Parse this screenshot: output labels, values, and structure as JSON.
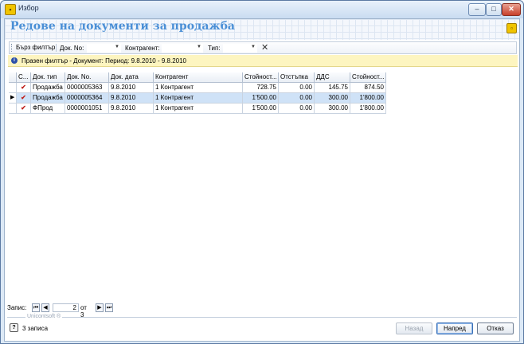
{
  "window": {
    "title": "Избор"
  },
  "header": {
    "title": "Редове на документи за продажба"
  },
  "toolbar": {
    "quick_filter": "Бърз филтър",
    "doc_no_label": "Док. No:",
    "contractor_label": "Контрагент:",
    "type_label": "Тип:"
  },
  "info": {
    "text": "Празен филтър - Документ: Период: 9.8.2010 - 9.8.2010"
  },
  "table": {
    "columns": [
      "С...",
      "Док. тип",
      "Док. No.",
      "Док. дата",
      "Контрагент",
      "Стойност...",
      "Отстъпка",
      "ДДС",
      "Стойност..."
    ],
    "rows": [
      {
        "checked": true,
        "type": "Продажба",
        "no": "0000005363",
        "date": "9.8.2010",
        "contractor": "1 Контрагент",
        "value": "728.75",
        "discount": "0.00",
        "vat": "145.75",
        "total": "874.50"
      },
      {
        "checked": true,
        "type": "Продажба",
        "no": "0000005364",
        "date": "9.8.2010",
        "contractor": "1 Контрагент",
        "value": "1'500.00",
        "discount": "0.00",
        "vat": "300.00",
        "total": "1'800.00"
      },
      {
        "checked": true,
        "type": "ФПрод",
        "no": "0000001051",
        "date": "9.8.2010",
        "contractor": "1 Контрагент",
        "value": "1'500.00",
        "discount": "0.00",
        "vat": "300.00",
        "total": "1'800.00"
      }
    ],
    "selected_row": 1
  },
  "navigator": {
    "label": "Запис:",
    "current": "2",
    "of_text": "от 3"
  },
  "footer": {
    "brand": "Unicontsoft ®",
    "record_count": "3 записа",
    "back_label": "Назад",
    "next_label": "Напред",
    "cancel_label": "Отказ"
  }
}
